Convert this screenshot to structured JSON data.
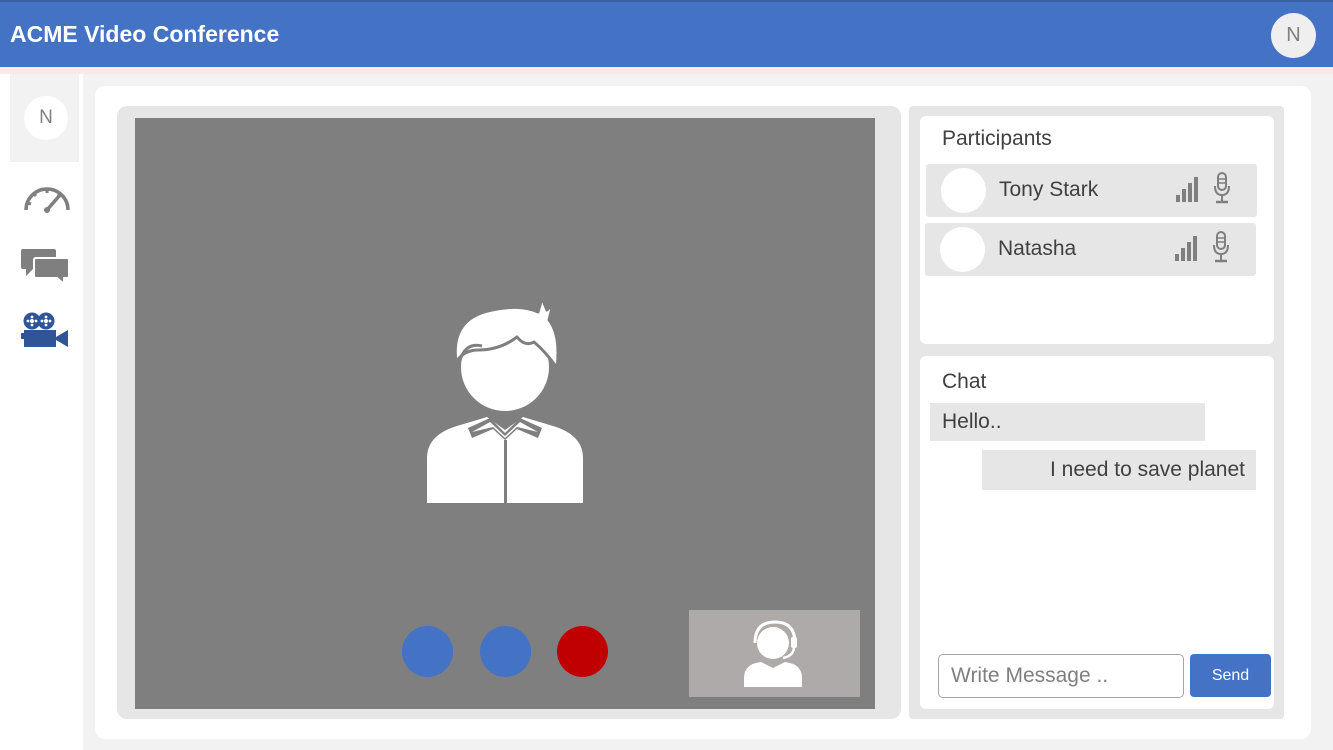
{
  "header": {
    "title": "ACME Video Conference",
    "avatar_initial": "N"
  },
  "sidebar": {
    "avatar_initial": "N",
    "items": [
      {
        "icon": "speedometer-icon"
      },
      {
        "icon": "chat-bubbles-icon"
      },
      {
        "icon": "video-camera-icon"
      }
    ]
  },
  "video": {
    "controls": [
      {
        "icon": "control-button",
        "color": "#4472c4"
      },
      {
        "icon": "control-button",
        "color": "#4472c4"
      },
      {
        "icon": "end-call-button",
        "color": "#c00000"
      }
    ]
  },
  "participants": {
    "title": "Participants",
    "list": [
      {
        "name": "Tony Stark"
      },
      {
        "name": "Natasha"
      }
    ]
  },
  "chat": {
    "title": "Chat",
    "messages": [
      {
        "text": "Hello..",
        "direction": "incoming"
      },
      {
        "text": "I need to save planet",
        "direction": "outgoing"
      }
    ],
    "input_placeholder": "Write Message ..",
    "send_label": "Send"
  },
  "colors": {
    "accent": "#4472c4",
    "end_call": "#c00000",
    "video_bg": "#7f7f7f"
  }
}
